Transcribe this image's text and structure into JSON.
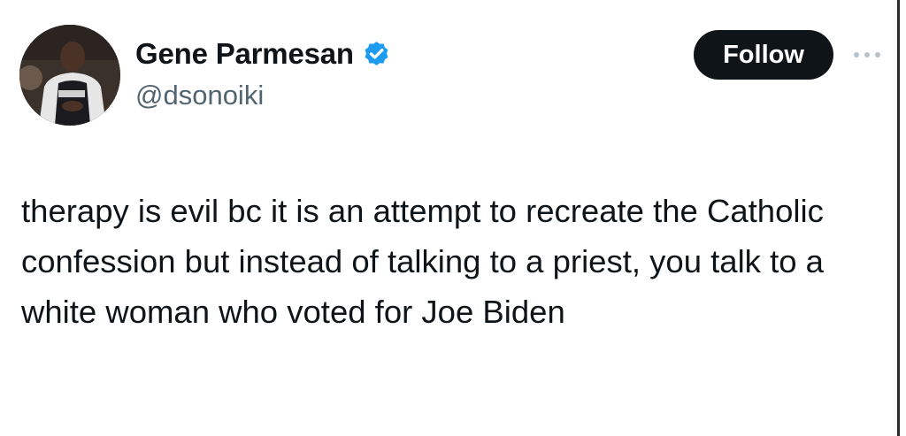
{
  "user": {
    "display_name": "Gene Parmesan",
    "handle": "@dsonoiki",
    "verified_icon": "verified-badge-icon",
    "avatar_icon": "avatar"
  },
  "actions": {
    "follow_label": "Follow",
    "more_icon": "more-options-icon"
  },
  "tweet": {
    "text": "therapy is evil bc it is an attempt to recreate the Catholic confession but instead of talking to a priest, you talk to a white woman who voted for Joe Biden"
  },
  "colors": {
    "text": "#0f1419",
    "secondary_text": "#536471",
    "verified_blue": "#1d9bf0",
    "button_bg": "#0f1419",
    "button_text": "#ffffff",
    "background": "#ffffff"
  }
}
